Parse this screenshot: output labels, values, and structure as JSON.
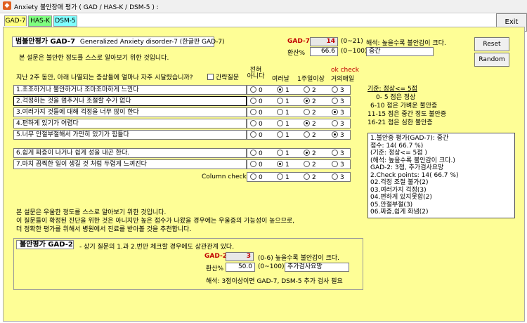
{
  "window": {
    "title": "Anxiety 불안장애 평가 ( GAD / HAS-K / DSM-5 ) :",
    "exit_label": "Exit"
  },
  "tabs": [
    {
      "label": "GAD-7",
      "color": "#ffff80",
      "active": true
    },
    {
      "label": "HAS-K",
      "color": "#80ff80",
      "active": false
    },
    {
      "label": "DSM-5",
      "color": "#80ffff",
      "active": false
    }
  ],
  "gad7": {
    "title": "범불안평가 GAD-7",
    "subtitle": "Generalized Anxiety disorder-7 (한글판 GAD-7)",
    "intro": "본 설문은 불안한 정도를 스스로 알아보기 위한 것입니다.",
    "score_label": "GAD-7",
    "score_value": "14",
    "score_range": "(0~21)",
    "interpretation": "해석: 높을수록 불안감이 크다.",
    "converted_label": "환산%",
    "converted_value": "66.6",
    "converted_range": "(0~100)",
    "level": "중간",
    "question_prompt": "지난 2주 동안, 아래 나열되는 증상들에 얼마나 자주 시달렸습니까?",
    "short_question_label": "간략질문",
    "ok_check": "ok check",
    "columns": [
      "전혀\n아니다",
      "여러날",
      "1주일이상",
      "거의매일"
    ],
    "questions": [
      {
        "label": "1.초조하거나 불안하거나 조마조마하게 느낀다",
        "selected": 1
      },
      {
        "label": "2.걱정하는 것을 멈추거나 조절할 수가 없다",
        "selected": 2
      },
      {
        "label": "3.여러가지 것들에 대해 걱정을 너무 많이 한다",
        "selected": 3
      },
      {
        "label": "4.편하게 있기가 어렵다",
        "selected": 2
      },
      {
        "label": "5.너무 안절부절해서 가만히 있기가 힘들다",
        "selected": 3
      },
      {
        "label": "6.쉽게 짜증이 나거나 쉽게 성을 내곤 한다.",
        "selected": 2
      },
      {
        "label": "7.마치 끔찍한 일이 생길 것 처럼 두렵게 느껴진다",
        "selected": 1
      }
    ],
    "options": [
      "0",
      "1",
      "2",
      "3"
    ],
    "column_check_label": "Column check"
  },
  "criteria": {
    "title": "기준: 정상<= 5점",
    "lines": [
      "0- 5 점은 정상",
      "6-10 점은 가벼운 불안증",
      "11-15 점은 중간 정도 불안증",
      "16-21 점은 심한 불안증"
    ]
  },
  "result_lines": [
    "1.불안증 평가(GAD-7): 중간",
    "  점수: 14( 66.7 %)",
    "  (기준: 정상<= 5점 )",
    "  (해석: 높을수록 불안감이 크다.)",
    "  GAD-2: 3점, 추가검사요망",
    "2.Check points: 14( 66.7 %)",
    "  02.걱정 조절 불가(2)",
    "  03.여러가지 걱정(3)",
    "  04.편하게 있지못함(2)",
    "  05.안절부절(3)",
    "  06.짜증,쉽게 화냄(2)"
  ],
  "buttons": {
    "reset": "Reset",
    "random": "Random"
  },
  "notice": [
    "본 설문은 우울한 정도를 스스로 알아보기 위한 것입니다.",
    "이 질문들이 확정된 진단을 위한 것은 아니지만 높은 점수가 나왔을 경우에는 우울증의 가능성이 높으므로,",
    "더 정확한 평가를 위해서 병원에서 진료를 받아볼 것을 추천합니다."
  ],
  "gad2": {
    "title": "불안평가 GAD-2",
    "desc": "- 상기 질문의 1.과 2.번만 체크할 경우에도 상관관계 있다.",
    "score_label": "GAD-2",
    "score_value": "3",
    "score_range": "(0-6) 높을수록 불안감이 크다.",
    "converted_label": "환산%",
    "converted_value": "50.0",
    "converted_range": "(0~100)",
    "level": "추가검사요망",
    "interpretation": "해석: 3점이상이면 GAD-7, DSM-5 추가 검사 필요"
  }
}
